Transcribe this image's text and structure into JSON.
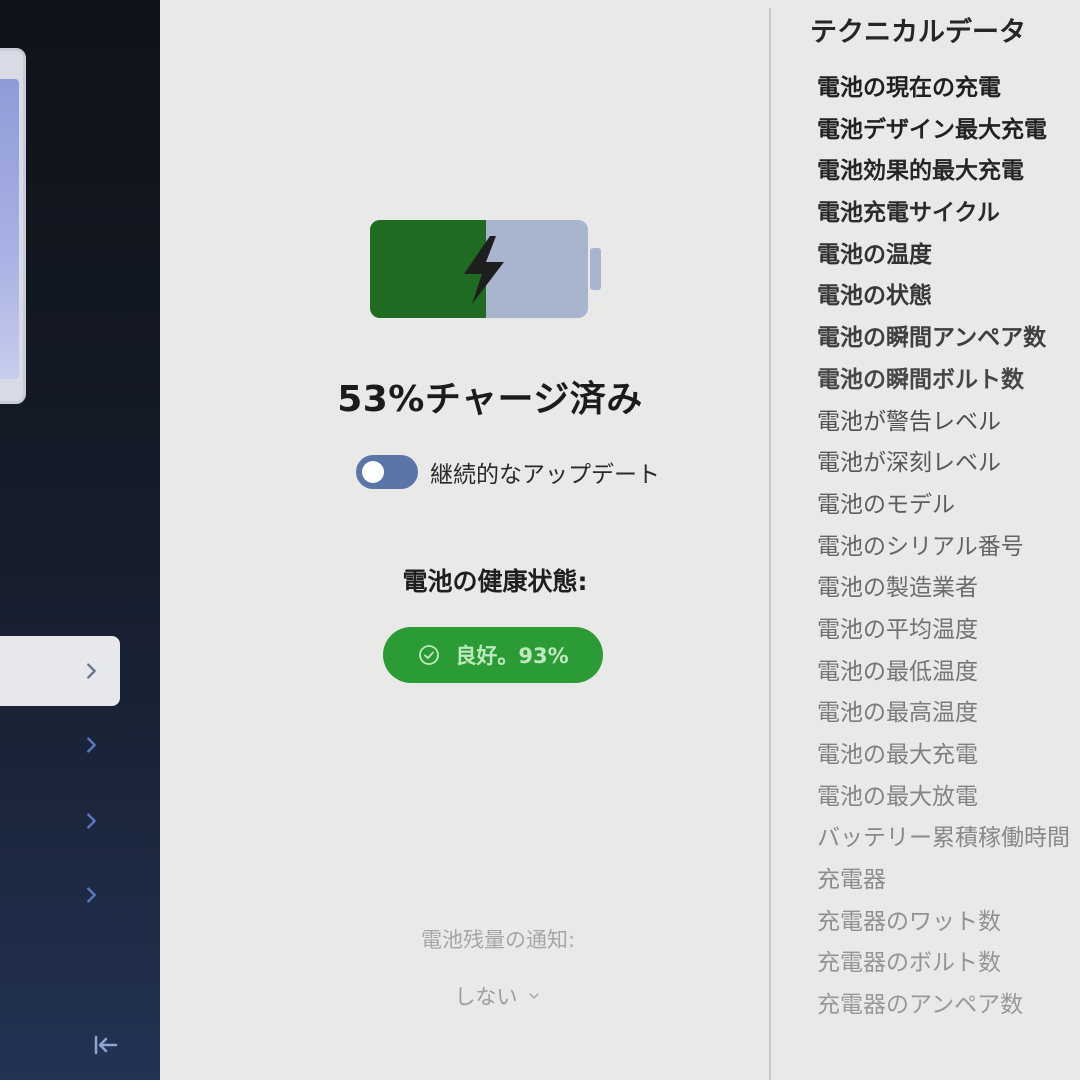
{
  "sidebar": {
    "items": [
      {
        "icon": "chevron-right-icon",
        "active": true
      },
      {
        "icon": "chevron-right-icon",
        "active": false
      },
      {
        "icon": "chevron-right-icon",
        "active": false
      },
      {
        "icon": "chevron-right-icon",
        "active": false
      }
    ],
    "collapse_icon": "collapse-left-icon"
  },
  "battery": {
    "charge_percent": 53,
    "charge_text": "53%チャージ済み",
    "icon": "battery-charging-icon",
    "fill_color": "#1f6b22",
    "empty_color": "#a9b4cf"
  },
  "continuous_update": {
    "label": "継続的なアップデート",
    "enabled": true
  },
  "health": {
    "title": "電池の健康状態:",
    "value": "良好。93%",
    "icon": "check-circle-icon",
    "color": "#2b9c35"
  },
  "notification": {
    "label": "電池残量の通知:",
    "selected": "しない",
    "icon": "chevron-down-icon"
  },
  "tech": {
    "title": "テクニカルデータ",
    "items": [
      "電池の現在の充電",
      "電池デザイン最大充電",
      "電池効果的最大充電",
      "電池充電サイクル",
      "電池の温度",
      "電池の状態",
      "電池の瞬間アンペア数",
      "電池の瞬間ボルト数",
      "電池が警告レベル",
      "電池が深刻レベル",
      "電池のモデル",
      "電池のシリアル番号",
      "電池の製造業者",
      "電池の平均温度",
      "電池の最低温度",
      "電池の最高温度",
      "電池の最大充電",
      "電池の最大放電",
      "バッテリー累積稼働時間",
      "充電器",
      "充電器のワット数",
      "充電器のボルト数",
      "充電器のアンペア数"
    ]
  }
}
